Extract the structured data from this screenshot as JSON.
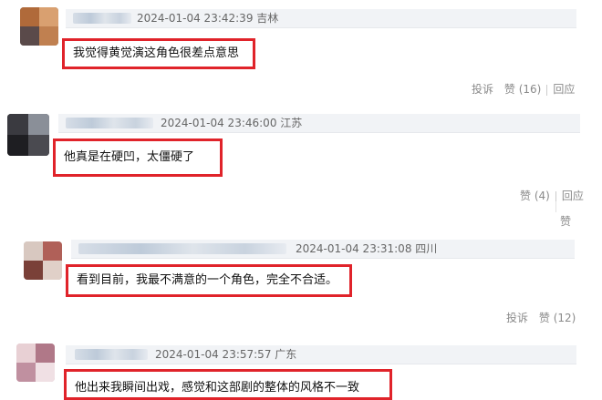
{
  "comments": [
    {
      "meta": "2024-01-04 23:42:39 吉林",
      "text": "我觉得黄觉演这角色很差点意思",
      "report": "投诉",
      "like": "赞",
      "like_count": "(16)",
      "reply": "回应"
    },
    {
      "meta": "2024-01-04 23:46:00 江苏",
      "text": "他真是在硬凹，太僵硬了",
      "like": "赞",
      "like_count": "(4)",
      "reply": "回应",
      "extra_like": "赞"
    },
    {
      "meta": "2024-01-04 23:31:08 四川",
      "text": "看到目前，我最不满意的一个角色，完全不合适。",
      "report": "投诉",
      "like": "赞",
      "like_count": "(12)"
    },
    {
      "meta": "2024-01-04 23:57:57 广东",
      "text": "他出来我瞬间出戏，感觉和这部剧的整体的风格不一致"
    }
  ],
  "colors": {
    "highlight": "#e0232a",
    "header_bg": "#f1f3f6",
    "meta_text": "#666666",
    "action_text": "#8a8a8a"
  }
}
